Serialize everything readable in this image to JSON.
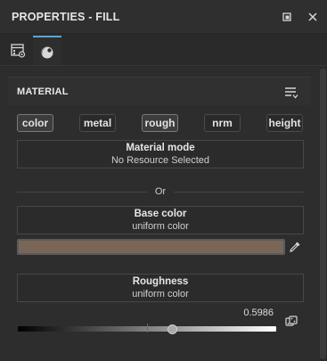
{
  "window": {
    "title": "PROPERTIES - FILL"
  },
  "section": {
    "title": "MATERIAL"
  },
  "channels": [
    {
      "label": "color",
      "active": true
    },
    {
      "label": "metal",
      "active": false
    },
    {
      "label": "rough",
      "active": true
    },
    {
      "label": "nrm",
      "active": false
    },
    {
      "label": "height",
      "active": false
    }
  ],
  "material_mode": {
    "label": "Material mode",
    "value": "No Resource Selected"
  },
  "separator_text": "Or",
  "base_color": {
    "label": "Base color",
    "value": "uniform color",
    "swatch": "#7a6657"
  },
  "roughness": {
    "label": "Roughness",
    "value": "uniform color",
    "amount": "0.5986",
    "fraction": 0.5986
  },
  "colors": {
    "accent": "#59a6d8"
  },
  "icons": {
    "restore": "restore-window-icon",
    "close": "close-icon",
    "tab1": "layer-properties-icon",
    "tab2": "material-sphere-icon",
    "menu": "list-menu-icon",
    "picker": "eyedropper-icon",
    "random": "dice-icon"
  }
}
